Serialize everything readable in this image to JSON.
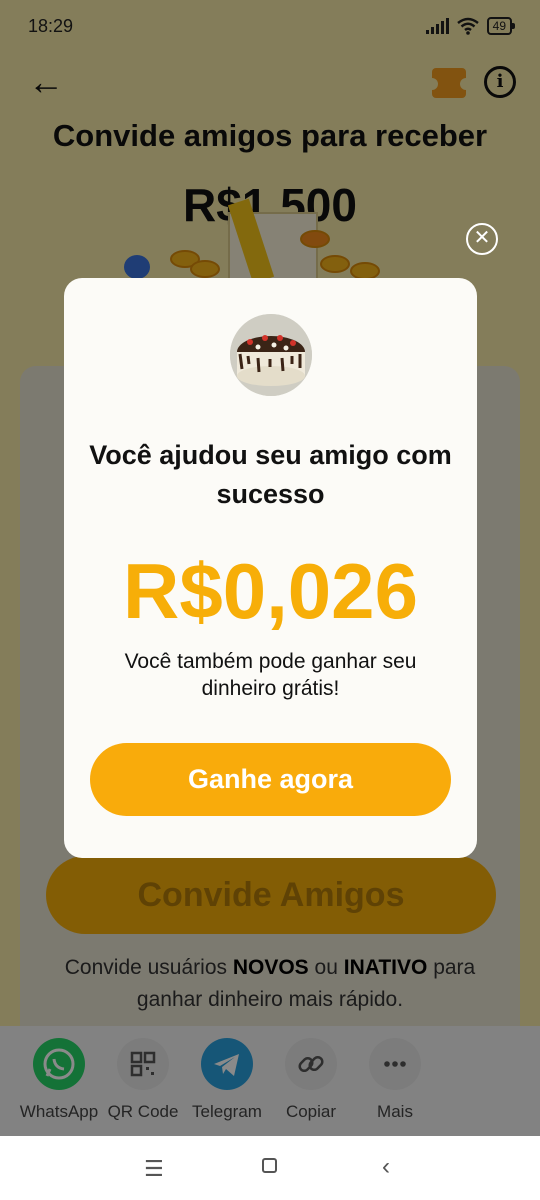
{
  "status_bar": {
    "time": "18:29",
    "battery": "49"
  },
  "header": {
    "back_icon": "arrow-left-icon",
    "ticket_icon": "ticket-icon",
    "info_icon": "info-icon"
  },
  "hero": {
    "title": "Convide amigos para receber",
    "amount": "R$1.500"
  },
  "invite": {
    "button_label": "Convide Amigos",
    "note_before": "Convide usuários ",
    "note_new": "NOVOS",
    "note_middle": " ou ",
    "note_inactive": "INATIVO",
    "note_after": " para ganhar dinheiro mais rápido."
  },
  "share": [
    {
      "label": "WhatsApp",
      "icon": "whatsapp-icon",
      "color": "#25d366"
    },
    {
      "label": "QR Code",
      "icon": "qr-code-icon",
      "color": "#e5e5e5"
    },
    {
      "label": "Telegram",
      "icon": "telegram-icon",
      "color": "#2aa0dc"
    },
    {
      "label": "Copiar",
      "icon": "link-icon",
      "color": "#e5e5e5"
    },
    {
      "label": "Mais",
      "icon": "more-icon",
      "color": "#e5e5e5"
    }
  ],
  "modal": {
    "title": "Você ajudou seu amigo com sucesso",
    "amount": "R$0,026",
    "subtitle": "Você também pode ganhar seu dinheiro grátis!",
    "cta_label": "Ganhe agora",
    "close_icon": "close-icon"
  },
  "nav": {
    "menu_icon": "menu-icon",
    "home_icon": "home-square-icon",
    "back_icon": "back-chevron-icon"
  },
  "colors": {
    "accent": "#f9ab0b",
    "amount": "#f7ae08",
    "background": "#f4e7a6"
  }
}
